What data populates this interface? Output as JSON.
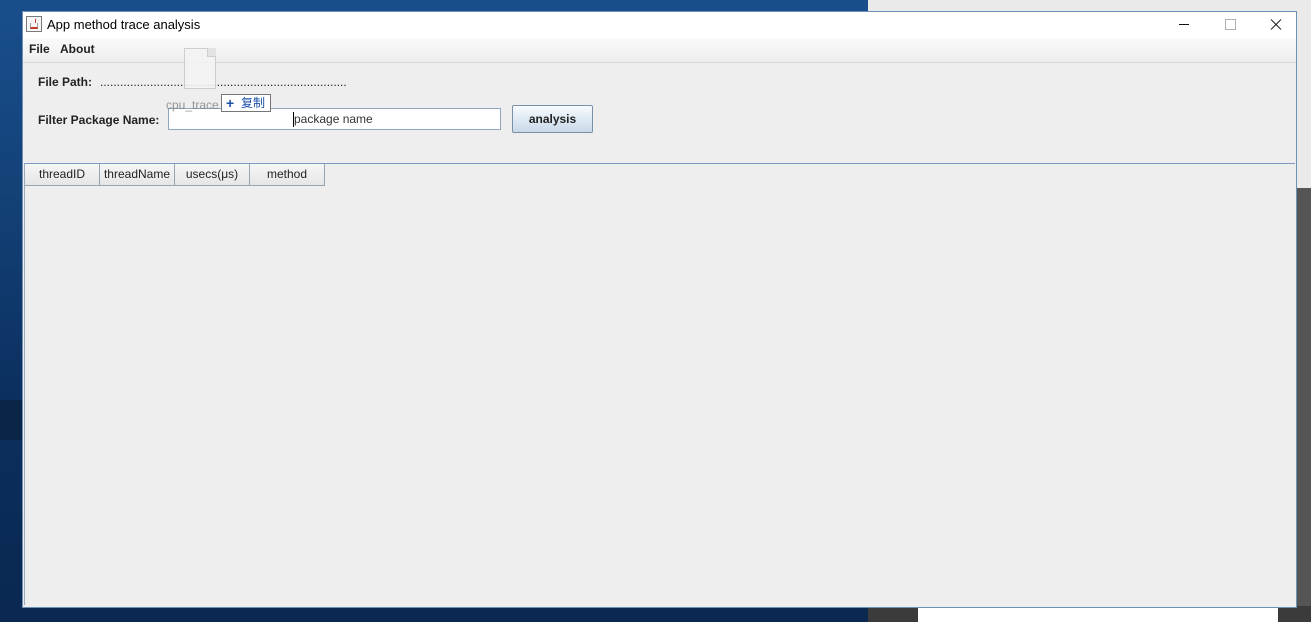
{
  "window": {
    "title": "App method trace analysis"
  },
  "menu": {
    "items": [
      "File",
      "About"
    ]
  },
  "form": {
    "file_path_label": "File Path:",
    "file_path_value": "............................................................................................",
    "filter_label": "Filter Package Name:",
    "filter_placeholder": "package name",
    "filter_value": "",
    "analysis_button": "analysis"
  },
  "table": {
    "columns": [
      "threadID",
      "threadName",
      "usecs(μs)",
      "method"
    ],
    "rows": []
  },
  "drag_overlay": {
    "file_label": "cpu_trace",
    "action_label": "复制",
    "action_icon": "plus-icon"
  },
  "colors": {
    "window_bg": "#eeeeee",
    "desktop_bg": "#123f75",
    "border_accent": "#6d8fb8",
    "copy_blue": "#1b4fa8"
  }
}
